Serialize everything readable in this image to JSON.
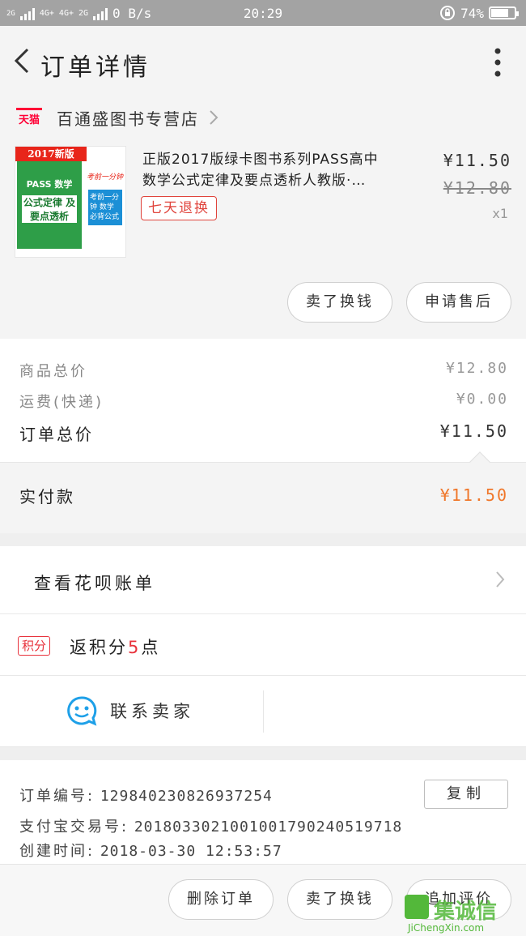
{
  "status_bar": {
    "network_1": "2G",
    "network_2": "4G+ 4G+",
    "network_3": "2G",
    "speed": "0 B/s",
    "time": "20:29",
    "battery": "74%",
    "battery_level": 0.74
  },
  "header": {
    "title": "订单详情"
  },
  "store": {
    "logo": "天猫",
    "name": "百通盛图书专营店"
  },
  "product": {
    "cover": {
      "banner": "2017新版",
      "book_title": "PASS 数学",
      "book_subtitle": "公式定律 及要点透析",
      "side_heading": "考前一分钟",
      "side_box": "考前一分钟 数学必背公式"
    },
    "title_line1": "正版2017版绿卡图书系列PASS高中",
    "title_line2": "数学公式定律及要点透析人教版·…",
    "tag": "七天退换",
    "price": "¥11.50",
    "original_price": "¥12.80",
    "quantity": "x1",
    "buttons": {
      "sell_exchange": "卖了换钱",
      "after_sale": "申请售后"
    }
  },
  "summary": {
    "goods_total_label": "商品总价",
    "goods_total": "¥12.80",
    "shipping_label": "运费(快递)",
    "shipping": "¥0.00",
    "order_total_label": "订单总价",
    "order_total": "¥11.50",
    "paid_label": "实付款",
    "paid": "¥11.50"
  },
  "huabei": {
    "label": "查看花呗账单"
  },
  "points": {
    "badge": "积分",
    "text_prefix": "返积分",
    "amount": "5",
    "text_suffix": "点"
  },
  "contact": {
    "label": "联系卖家"
  },
  "order_info": {
    "order_no_label": "订单编号:",
    "order_no": "129840230826937254",
    "copy_button": "复制",
    "alipay_no_label": "支付宝交易号:",
    "alipay_no": "2018033021001001790240519718",
    "created_label": "创建时间:",
    "created": "2018-03-30 12:53:57"
  },
  "bottom_bar": {
    "delete_order": "删除订单",
    "sell_exchange": "卖了换钱",
    "add_review": "追加评价"
  },
  "watermark": {
    "logo_text": "集诚信",
    "url": "JiChengXin.com"
  },
  "colors": {
    "accent_red": "#e0443c",
    "paid_orange": "#f0772a",
    "tmall_red": "#ff0036",
    "contact_blue": "#1ea0e8"
  }
}
